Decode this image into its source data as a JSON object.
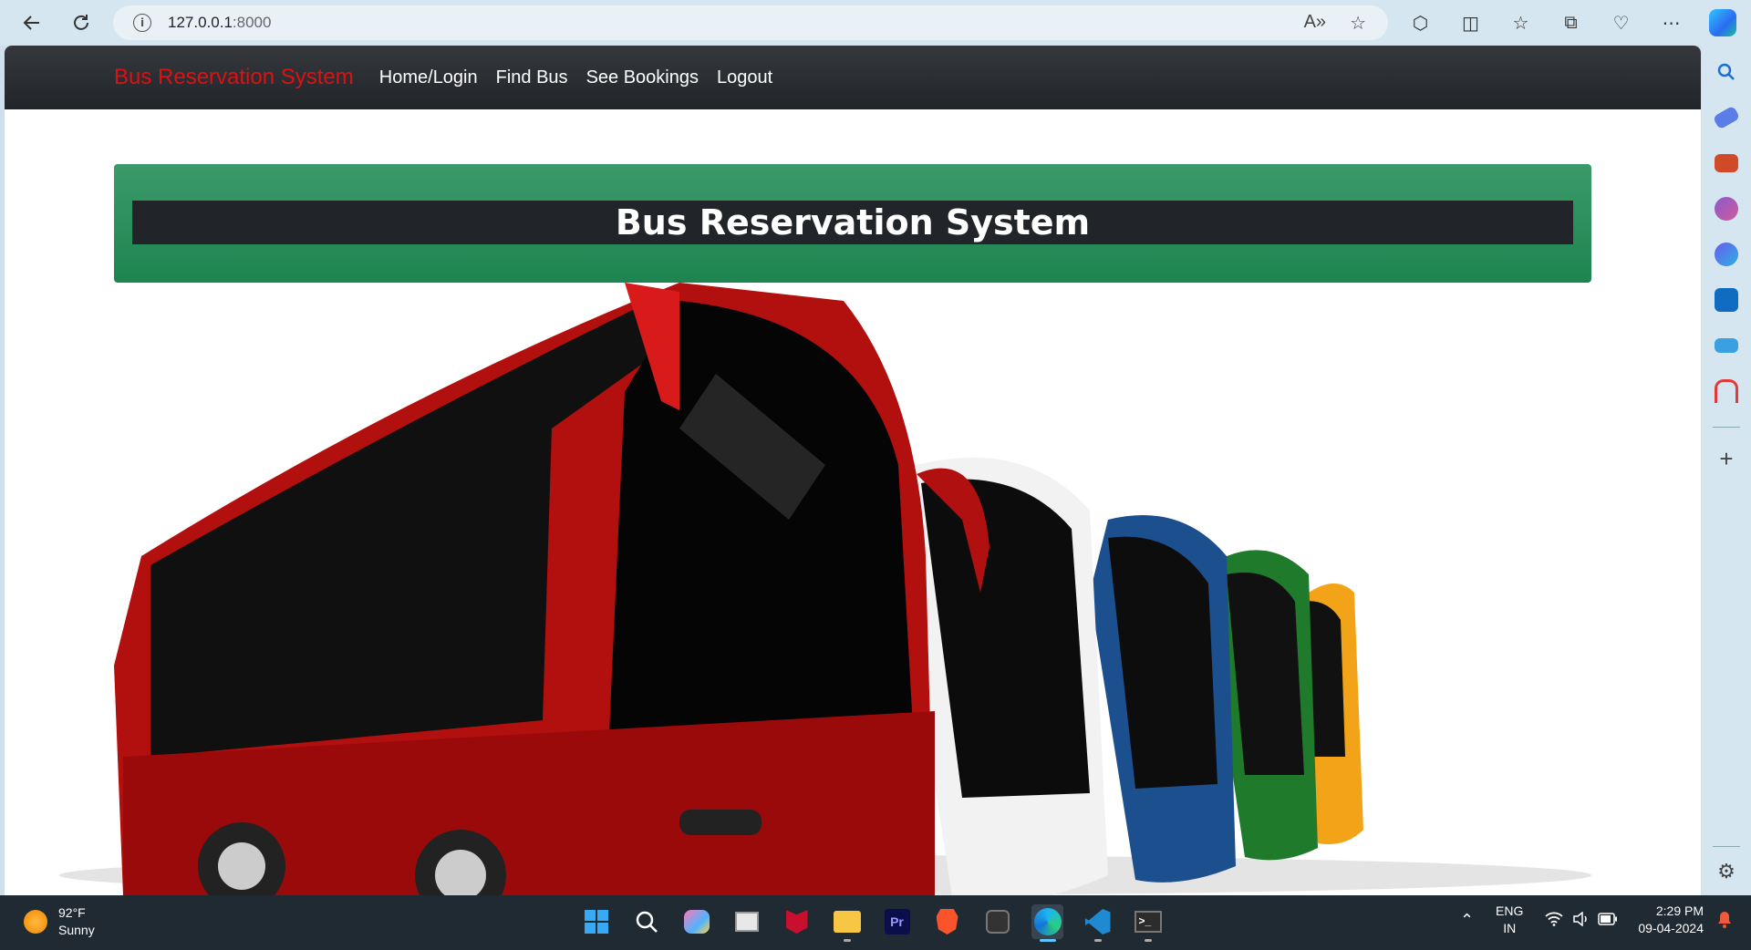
{
  "browser": {
    "url_host": "127.0.0.1",
    "url_port": ":8000"
  },
  "navbar": {
    "brand": "Bus Reservation System",
    "links": [
      "Home/Login",
      "Find Bus",
      "See Bookings",
      "Logout"
    ]
  },
  "hero": {
    "title": "Bus Reservation System"
  },
  "taskbar": {
    "weather_temp": "92°F",
    "weather_desc": "Sunny",
    "lang_primary": "ENG",
    "lang_secondary": "IN",
    "time": "2:29 PM",
    "date": "09-04-2024"
  },
  "colors": {
    "brand_red": "#dd1111",
    "banner_green": "#1d8450",
    "navbar_dark": "#212529"
  }
}
